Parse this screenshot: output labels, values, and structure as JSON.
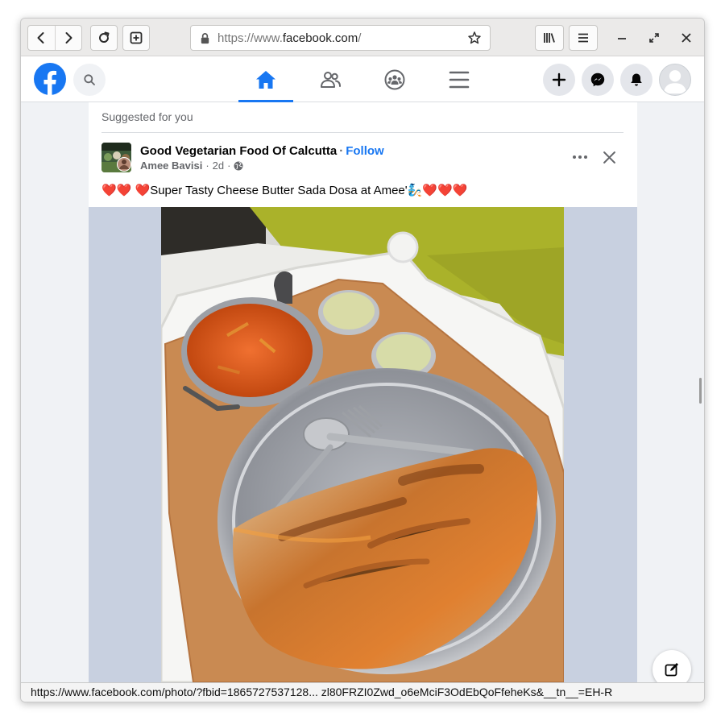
{
  "browser": {
    "url_prefix": "https://www.",
    "url_domain": "facebook.com",
    "url_suffix": "/",
    "status_url": "https://www.facebook.com/photo/?fbid=1865727537128... zl80FRZI0Zwd_o6eMciF3OdEbQoFfeheKs&__tn__=EH-R",
    "icons": [
      "back-icon",
      "forward-icon",
      "reload-icon",
      "new-tab-icon",
      "lock-icon",
      "bookmark-star-icon",
      "library-icon",
      "menu-icon",
      "minimize-icon",
      "restore-icon",
      "close-icon"
    ]
  },
  "facebook": {
    "nav_tabs": [
      "home-icon",
      "friends-icon",
      "groups-icon",
      "menu-icon"
    ],
    "active_tab": "home",
    "accent": "#1877f2"
  },
  "post": {
    "suggested_label": "Suggested for you",
    "page_name": "Good Vegetarian Food Of Calcutta",
    "separator": "·",
    "follow_label": "Follow",
    "author": "Amee Bavisi",
    "time": "2d",
    "caption_start": "Super Tasty Cheese Butter Sada Dosa at Amee'",
    "caption_hearts_before": "❤️❤️ ❤️",
    "caption_hearts_after": "❤️❤️❤️",
    "caption_emoji": "🧞"
  }
}
